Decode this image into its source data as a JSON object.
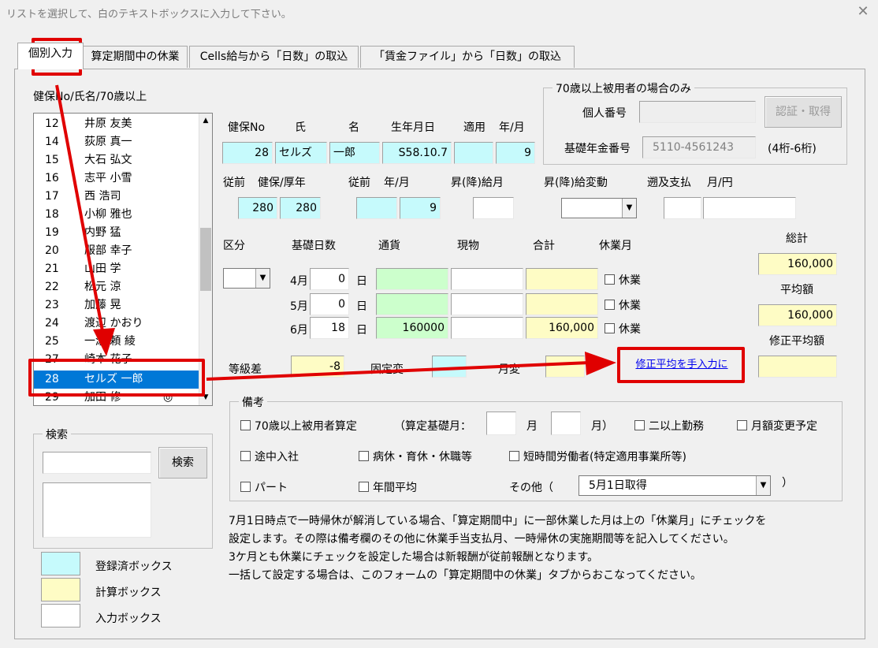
{
  "window": {
    "title": "リストを選択して、白のテキストボックスに入力して下さい。",
    "close": "✕"
  },
  "tabs": [
    "個別入力",
    "算定期間中の休業",
    "Cells給与から「日数」の取込",
    "「賃金ファイル」から「日数」の取込"
  ],
  "list": {
    "header": "健保No/氏名/70歳以上",
    "items": [
      {
        "no": "12",
        "name": "井原 友美"
      },
      {
        "no": "14",
        "name": "荻原 真一"
      },
      {
        "no": "15",
        "name": "大石 弘文"
      },
      {
        "no": "16",
        "name": "志平 小雪"
      },
      {
        "no": "17",
        "name": "西 浩司"
      },
      {
        "no": "18",
        "name": "小柳 雅也"
      },
      {
        "no": "19",
        "name": "内野 猛"
      },
      {
        "no": "20",
        "name": "服部 幸子"
      },
      {
        "no": "21",
        "name": "山田 学"
      },
      {
        "no": "22",
        "name": "松元 涼"
      },
      {
        "no": "23",
        "name": "加藤 晃"
      },
      {
        "no": "24",
        "name": "渡辺 かおり"
      },
      {
        "no": "25",
        "name": "一瀬 頼 綾"
      },
      {
        "no": "27",
        "name": "崎本 花子"
      },
      {
        "no": "28",
        "name": "セルズ 一郎"
      },
      {
        "no": "29",
        "name": "加田 修"
      }
    ],
    "selected_index": 14,
    "extra_mark": "◎"
  },
  "search": {
    "title": "検索",
    "button": "検索",
    "input_value": ""
  },
  "legend": [
    {
      "label": "登録済ボックス",
      "color": "#c6fafc"
    },
    {
      "label": "計算ボックス",
      "color": "#fefcc5"
    },
    {
      "label": "入力ボックス",
      "color": "#ffffff"
    }
  ],
  "basic": {
    "headers": {
      "no": "健保No",
      "sei": "氏",
      "mei": "名",
      "birth": "生年月日",
      "tekiyo": "適用",
      "ym": "年/月"
    },
    "values": {
      "no": "28",
      "sei": "セルズ",
      "mei": "一郎",
      "birth": "S58.10.7",
      "tekiyo": "",
      "ym": "9"
    }
  },
  "previous": {
    "headers": {
      "prev": "従前",
      "kenpo": "健保/厚年",
      "prev2": "従前",
      "ym": "年/月",
      "raise_pay": "昇(降)給月",
      "raise_change": "昇(降)給変動",
      "retro": "遡及支払",
      "retro_unit": "月/円"
    },
    "values": {
      "kenpo": "280",
      "kosei": "280",
      "year": "",
      "month": "9"
    }
  },
  "over70": {
    "title": "70歳以上被用者の場合のみ",
    "personal_no_label": "個人番号",
    "auth_button": "認証・取得",
    "pension_label": "基礎年金番号",
    "pension_value": "5110-4561243",
    "pension_hint": "(4桁-6桁)"
  },
  "calc": {
    "headers": {
      "kubun": "区分",
      "days": "基礎日数",
      "currency": "通貨",
      "goods": "現物",
      "total": "合計",
      "leave": "休業月"
    },
    "day_unit": "日",
    "leave_label": "休業",
    "rows": [
      {
        "month": "4月",
        "days": "0",
        "currency": "",
        "goods": "",
        "total": ""
      },
      {
        "month": "5月",
        "days": "0",
        "currency": "",
        "goods": "",
        "total": ""
      },
      {
        "month": "6月",
        "days": "18",
        "currency": "160000",
        "goods": "",
        "total": "160,000"
      }
    ],
    "grand_total_label": "総計",
    "grand_total": "160,000",
    "average_label": "平均額",
    "average": "160,000",
    "adjusted_label": "修正平均額",
    "adjusted": ""
  },
  "grade": {
    "label": "等級差",
    "value": "-8",
    "fixed_label": "固定変",
    "month_label": "月変",
    "manual_link": "修正平均を手入力に"
  },
  "remarks": {
    "title": "備考",
    "c70": "70歳以上被用者算定",
    "base_month_label": "（算定基礎月：",
    "month1": "月",
    "month2": "月）",
    "multi": "二以上勤務",
    "monthly_change": "月額変更予定",
    "midjoin": "途中入社",
    "sick": "病休・育休・休職等",
    "short": "短時間労働者(特定適用事業所等)",
    "part": "パート",
    "annual": "年間平均",
    "other_label": "その他（",
    "other_value": "5月1日取得",
    "other_close": "）"
  },
  "note": [
    "7月1日時点で一時帰休が解消している場合、「算定期間中」に一部休業した月は上の「休業月」にチェックを",
    "設定します。その際は備考欄のその他に休業手当支払月、一時帰休の実施期間等を記入してください。",
    "3ケ月とも休業にチェックを設定した場合は新報酬が従前報酬となります。",
    "一括して設定する場合は、このフォームの「算定期間中の休業」タブからおこなってください。"
  ]
}
